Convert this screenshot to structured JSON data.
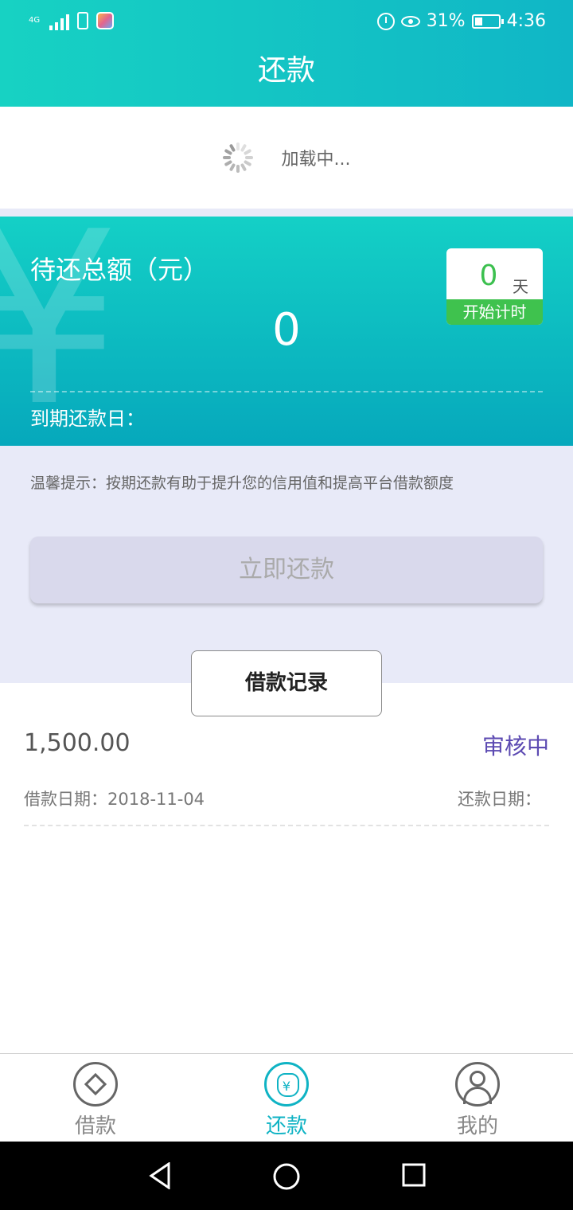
{
  "status_bar": {
    "network": "4G",
    "battery_text": "31%",
    "battery_level": 0.31,
    "time": "4:36"
  },
  "header": {
    "title": "还款"
  },
  "loading": {
    "text": "加载中..."
  },
  "summary": {
    "label": "待还总额（元）",
    "amount": "0",
    "days_value": "0",
    "days_unit": "天",
    "days_label": "开始计时",
    "due_label": "到期还款日："
  },
  "tips": {
    "text": "温馨提示：按期还款有助于提升您的信用值和提高平台借款额度"
  },
  "actions": {
    "repay_now": "立即还款",
    "records": "借款记录"
  },
  "records": [
    {
      "amount": "1,500.00",
      "status": "审核中",
      "borrow_date": "借款日期：2018-11-04",
      "repay_date": "还款日期："
    }
  ],
  "tabbar": {
    "items": [
      {
        "label": "借款",
        "icon": "diamond-icon",
        "active": false
      },
      {
        "label": "还款",
        "icon": "money-bag-icon",
        "active": true
      },
      {
        "label": "我的",
        "icon": "user-icon",
        "active": false
      }
    ]
  },
  "colors": {
    "accent": "#0fb3c4",
    "status_pending": "#5c4ab2",
    "counter_green": "#3fc24e"
  }
}
